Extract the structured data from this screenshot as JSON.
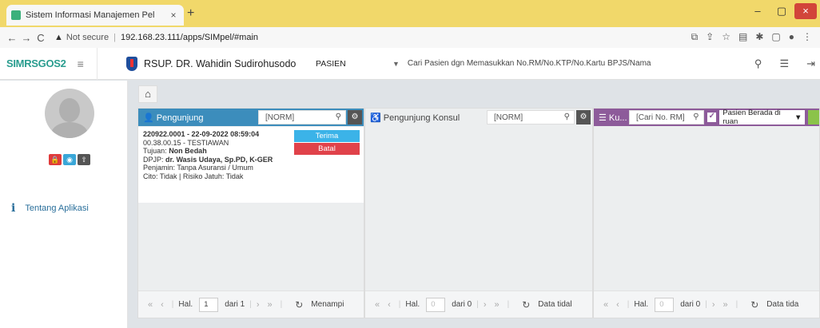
{
  "browser": {
    "tab_title": "Sistem Informasi Manajemen Pel",
    "tab_close": "×",
    "new_tab": "+",
    "security": "Not secure",
    "url": "192.168.23.111/apps/SIMpel/#main",
    "win_min": "–",
    "win_max": "▢",
    "win_close": "×"
  },
  "app": {
    "logo_text": "SIMRSGOS2",
    "hospital_name": "RSUP. DR. Wahidin Sudirohusodo",
    "context_label": "PASIEN",
    "search_placeholder": "Cari Pasien dgn Memasukkan No.RM/No.KTP/No.Kartu BPJS/Nama"
  },
  "sidebar": {
    "about_label": "Tentang Aplikasi"
  },
  "panels": {
    "pengunjung": {
      "title": "Pengunjung",
      "filter_placeholder": "[NORM]",
      "card": {
        "line1": "220922.0001 - 22-09-2022 08:59:04",
        "line2": "00.38.00.15 - TESTIAWAN",
        "tujuan_label": "Tujuan: ",
        "tujuan_value": "Non Bedah",
        "dpjp_label": "DPJP: ",
        "dpjp_value": "dr. Wasis Udaya, Sp.PD, K-GER",
        "penjamin": "Penjamin: Tanpa Asuransi / Umum",
        "cito": "Cito: Tidak | Risiko Jatuh: Tidak",
        "terima_label": "Terima",
        "batal_label": "Batal"
      },
      "pager": {
        "hal": "Hal.",
        "page": "1",
        "of": "dari 1",
        "info": "Menampi"
      }
    },
    "konsul": {
      "title": "Pengunjung Konsul",
      "filter_placeholder": "[NORM]",
      "pager": {
        "hal": "Hal.",
        "page": "0",
        "of": "dari 0",
        "info": "Data tidal"
      }
    },
    "kunjungan": {
      "title": "Ku...",
      "filter_placeholder": "[Cari No. RM]",
      "select_value": "Pasien Berada di ruan",
      "pager": {
        "hal": "Hal.",
        "page": "0",
        "of": "dari 0",
        "info": "Data tida"
      }
    }
  },
  "colors": {
    "pengunjung_header": "#3c8dbc",
    "kunjungan_header": "#8d5b9a",
    "terima": "#3bb3e8",
    "batal": "#e0424a"
  }
}
